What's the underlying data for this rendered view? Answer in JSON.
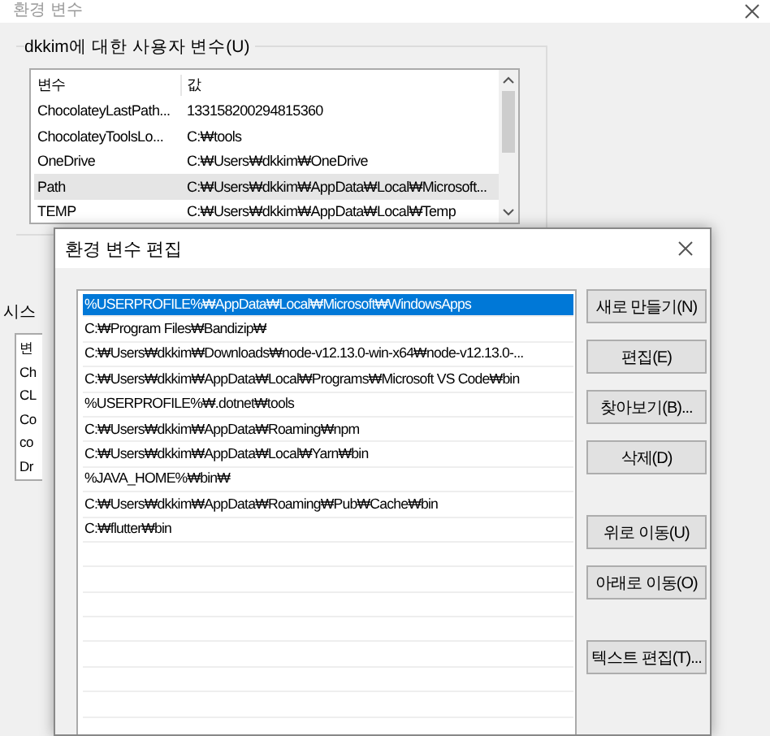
{
  "back_window": {
    "title": "환경 변수",
    "user_vars": {
      "label": "dkkim에 대한 사용자 변수(U)",
      "columns": [
        "변수",
        "값"
      ],
      "rows": [
        {
          "name": "ChocolateyLastPath...",
          "value": "133158200294815360",
          "selected": false
        },
        {
          "name": "ChocolateyToolsLo...",
          "value": "C:₩tools",
          "selected": false
        },
        {
          "name": "OneDrive",
          "value": "C:₩Users₩dkkim₩OneDrive",
          "selected": false
        },
        {
          "name": "Path",
          "value": "C:₩Users₩dkkim₩AppData₩Local₩Microsoft...",
          "selected": true
        },
        {
          "name": "TEMP",
          "value": "C:₩Users₩dkkim₩AppData₩Local₩Temp",
          "selected": false
        }
      ]
    },
    "system_vars": {
      "label": "시스",
      "rows": [
        "변",
        "Ch",
        "CL",
        "Co",
        "co",
        "Dr"
      ]
    }
  },
  "edit_dialog": {
    "title": "환경 변수 편집",
    "entries": [
      {
        "text": "%USERPROFILE%₩AppData₩Local₩Microsoft₩WindowsApps",
        "selected": true
      },
      {
        "text": "C:₩Program Files₩Bandizip₩",
        "selected": false
      },
      {
        "text": "C:₩Users₩dkkim₩Downloads₩node-v12.13.0-win-x64₩node-v12.13.0-...",
        "selected": false
      },
      {
        "text": "C:₩Users₩dkkim₩AppData₩Local₩Programs₩Microsoft VS Code₩bin",
        "selected": false
      },
      {
        "text": "%USERPROFILE%₩.dotnet₩tools",
        "selected": false
      },
      {
        "text": "C:₩Users₩dkkim₩AppData₩Roaming₩npm",
        "selected": false
      },
      {
        "text": "C:₩Users₩dkkim₩AppData₩Local₩Yarn₩bin",
        "selected": false
      },
      {
        "text": "%JAVA_HOME%₩bin₩",
        "selected": false
      },
      {
        "text": "C:₩Users₩dkkim₩AppData₩Roaming₩Pub₩Cache₩bin",
        "selected": false
      },
      {
        "text": "C:₩flutter₩bin",
        "selected": false
      }
    ],
    "button_groups": [
      [
        "새로 만들기(N)",
        "편집(E)",
        "찾아보기(B)...",
        "삭제(D)"
      ],
      [
        "위로 이동(U)",
        "아래로 이동(O)"
      ],
      [
        "텍스트 편집(T)..."
      ]
    ]
  }
}
